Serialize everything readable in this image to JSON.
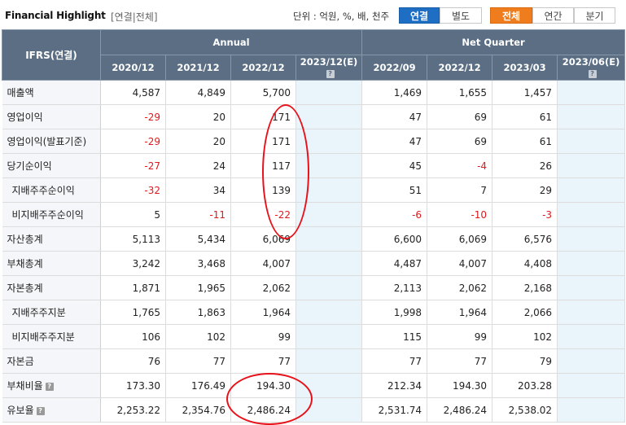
{
  "header": {
    "title": "Financial Highlight",
    "subtitle": "[연결|전체]",
    "unit_label": "단위 : 억원, %, 배, 천주",
    "buttons": {
      "consolidated": "연결",
      "separate": "별도",
      "all": "전체",
      "annual": "연간",
      "quarter": "분기"
    }
  },
  "table": {
    "corner_label": "IFRS(연결)",
    "groups": [
      "Annual",
      "Net Quarter"
    ],
    "columns": [
      "2020/12",
      "2021/12",
      "2022/12",
      "2023/12(E)",
      "2022/09",
      "2022/12",
      "2023/03",
      "2023/06(E)"
    ],
    "help_icon_glyph": "?",
    "rows": [
      {
        "label": "매출액",
        "values": [
          "4,587",
          "4,849",
          "5,700",
          "",
          "1,469",
          "1,655",
          "1,457",
          ""
        ]
      },
      {
        "label": "영업이익",
        "values": [
          "-29",
          "20",
          "171",
          "",
          "47",
          "69",
          "61",
          ""
        ]
      },
      {
        "label": "영업이익(발표기준)",
        "values": [
          "-29",
          "20",
          "171",
          "",
          "47",
          "69",
          "61",
          ""
        ]
      },
      {
        "label": "당기순이익",
        "values": [
          "-27",
          "24",
          "117",
          "",
          "45",
          "-4",
          "26",
          ""
        ]
      },
      {
        "label": "지배주주순이익",
        "values": [
          "-32",
          "34",
          "139",
          "",
          "51",
          "7",
          "29",
          ""
        ]
      },
      {
        "label": "비지배주주순이익",
        "values": [
          "5",
          "-11",
          "-22",
          "",
          "-6",
          "-10",
          "-3",
          ""
        ]
      },
      {
        "label": "자산총계",
        "values": [
          "5,113",
          "5,434",
          "6,069",
          "",
          "6,600",
          "6,069",
          "6,576",
          ""
        ]
      },
      {
        "label": "부채총계",
        "values": [
          "3,242",
          "3,468",
          "4,007",
          "",
          "4,487",
          "4,007",
          "4,408",
          ""
        ]
      },
      {
        "label": "자본총계",
        "values": [
          "1,871",
          "1,965",
          "2,062",
          "",
          "2,113",
          "2,062",
          "2,168",
          ""
        ]
      },
      {
        "label": "지배주주지분",
        "values": [
          "1,765",
          "1,863",
          "1,964",
          "",
          "1,998",
          "1,964",
          "2,066",
          ""
        ]
      },
      {
        "label": "비지배주주지분",
        "values": [
          "106",
          "102",
          "99",
          "",
          "115",
          "99",
          "102",
          ""
        ]
      },
      {
        "label": "자본금",
        "values": [
          "76",
          "77",
          "77",
          "",
          "77",
          "77",
          "79",
          ""
        ]
      },
      {
        "label": "부채비율",
        "values": [
          "173.30",
          "176.49",
          "194.30",
          "",
          "212.34",
          "194.30",
          "203.28",
          ""
        ]
      },
      {
        "label": "유보율",
        "values": [
          "2,253.22",
          "2,354.76",
          "2,486.24",
          "",
          "2,531.74",
          "2,486.24",
          "2,538.02",
          ""
        ]
      }
    ]
  },
  "colors": {
    "header_bg": "#5b6e84",
    "negative": "#e0191c",
    "estimate_bg": "#e9f4fb",
    "active_blue": "#1e6fc4",
    "active_orange": "#ef7d1e",
    "annotation": "#e8121a"
  }
}
